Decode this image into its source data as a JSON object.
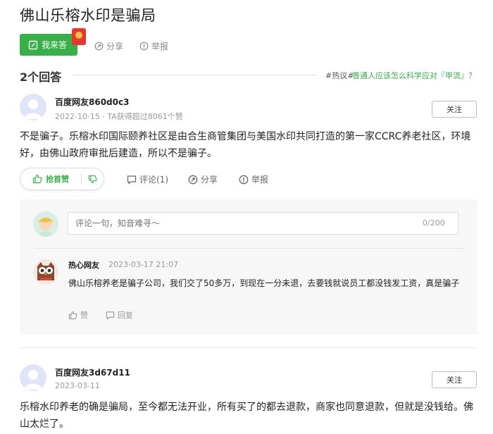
{
  "question": {
    "title": "佛山乐榕水印是骗局"
  },
  "header": {
    "answer_button": "我来答",
    "share": "分享",
    "report": "举报"
  },
  "answers_header": {
    "count": "2个回答",
    "hot_tag": "#热议#",
    "hot_link": "普通人应该怎么科学应对『甲流』？"
  },
  "answers": [
    {
      "user": "百度网友860d0c3",
      "meta": "2022-10-15 · TA获得超过8061个赞",
      "follow": "关注",
      "text": "不是骗子。乐榕水印国际颐养社区是由合生商管集团与美国水印共同打造的第一家CCRC养老社区，环境好，由佛山政府审批后建造，所以不是骗子。",
      "upvote": "抢首赞",
      "comment": "评论(1)",
      "share": "分享",
      "report": "举报",
      "comment_box": {
        "placeholder": "评论一句，知音难寻～",
        "counter": "0/200"
      },
      "comments": [
        {
          "user": "热心网友",
          "date": "2023-03-17 21:07",
          "text": "佛山乐榕养老是骗子公司，我们交了50多万，到现在一分未退，去要钱就说员工都没钱发工资，真是骗子",
          "like": "赞",
          "reply": "回复"
        }
      ]
    },
    {
      "user": "百度网友3d67d11",
      "meta": "2023-03-11",
      "follow": "关注",
      "text": "乐榕水印养老的确是骗局，至今都无法开业，所有买了的都去退款，商家也同意退款，但就是没钱给。佛山太烂了。"
    }
  ],
  "colors": {
    "brand_green": "#38b048",
    "redpack": "#e6382f"
  }
}
